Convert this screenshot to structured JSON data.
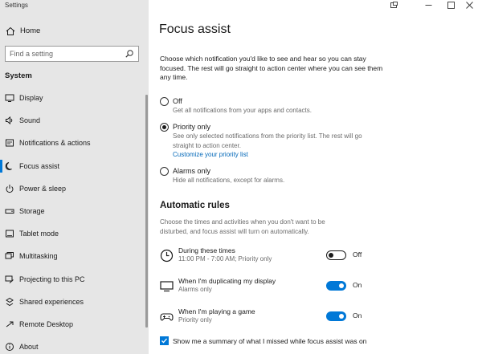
{
  "window": {
    "title": "Settings"
  },
  "sidebar": {
    "home_label": "Home",
    "search_placeholder": "Find a setting",
    "section_label": "System",
    "items": [
      {
        "label": "Display",
        "icon": "display-icon"
      },
      {
        "label": "Sound",
        "icon": "sound-icon"
      },
      {
        "label": "Notifications & actions",
        "icon": "notifications-icon"
      },
      {
        "label": "Focus assist",
        "icon": "moon-icon"
      },
      {
        "label": "Power & sleep",
        "icon": "power-icon"
      },
      {
        "label": "Storage",
        "icon": "storage-icon"
      },
      {
        "label": "Tablet mode",
        "icon": "tablet-icon"
      },
      {
        "label": "Multitasking",
        "icon": "multitasking-icon"
      },
      {
        "label": "Projecting to this PC",
        "icon": "projecting-icon"
      },
      {
        "label": "Shared experiences",
        "icon": "shared-icon"
      },
      {
        "label": "Remote Desktop",
        "icon": "remote-desktop-icon"
      },
      {
        "label": "About",
        "icon": "info-icon"
      }
    ],
    "selected_item": "Focus assist"
  },
  "main": {
    "title": "Focus assist",
    "intro": "Choose which notification you'd like to see and hear so you can stay focused. The rest will go straight to action center where you can see them any time.",
    "options": [
      {
        "label": "Off",
        "desc": "Get all notifications from your apps and contacts.",
        "selected": false
      },
      {
        "label": "Priority only",
        "desc": "See only selected notifications from the priority list. The rest will go straight to action center.",
        "link": "Customize your priority list",
        "selected": true
      },
      {
        "label": "Alarms only",
        "desc": "Hide all notifications, except for alarms.",
        "selected": false
      }
    ],
    "rules_title": "Automatic rules",
    "rules_desc": "Choose the times and activities when you don't want to be disturbed, and focus assist will turn on automatically.",
    "rules": [
      {
        "title": "During these times",
        "subtitle": "11:00 PM - 7:00 AM; Priority only",
        "state": "Off",
        "icon": "clock-icon"
      },
      {
        "title": "When I'm duplicating my display",
        "subtitle": "Alarms only",
        "state": "On",
        "icon": "monitor-icon"
      },
      {
        "title": "When I'm playing a game",
        "subtitle": "Priority only",
        "state": "On",
        "icon": "gamepad-icon"
      }
    ],
    "summary_checkbox_label": "Show me a summary of what I missed while focus assist was on",
    "summary_checked": true
  },
  "colors": {
    "accent": "#0078d7",
    "link": "#0067b8",
    "sidebar_bg": "#e6e6e6"
  }
}
